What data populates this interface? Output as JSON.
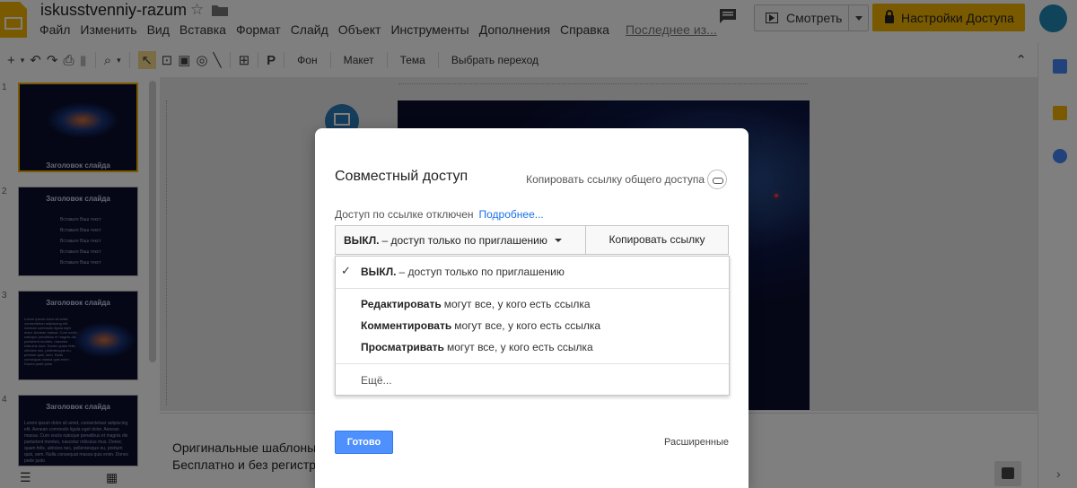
{
  "header": {
    "doc_title": "iskusstvenniy-razum",
    "menu": [
      "Файл",
      "Изменить",
      "Вид",
      "Вставка",
      "Формат",
      "Слайд",
      "Объект",
      "Инструменты",
      "Дополнения",
      "Справка"
    ],
    "last_edit": "Последнее из...",
    "present_label": "Смотреть",
    "share_label": "Настройки Доступа",
    "accent_color": "#f4b400"
  },
  "toolbar": {
    "background_label": "Фон",
    "layout_label": "Макет",
    "theme_label": "Тема",
    "transition_label": "Выбрать переход"
  },
  "filmstrip": {
    "slides": [
      {
        "number": "1",
        "title": "Заголовок слайда"
      },
      {
        "number": "2",
        "title": "Заголовок слайда",
        "items": [
          "Вставьте Ваш текст",
          "Вставьте Ваш текст",
          "Вставьте Ваш текст",
          "Вставьте Ваш текст",
          "Вставьте Ваш текст"
        ]
      },
      {
        "number": "3",
        "title": "Заголовок слайда"
      },
      {
        "number": "4",
        "title": "Заголовок слайда"
      }
    ],
    "body_text": "Lorem ipsum dolor sit amet, consectetuer adipiscing elit. Aenean commodo ligula eget dolor. Aenean massa. Cum sociis natoque penatibus et magnis dis parturient montes, nascetur ridiculus mus. Donec quam felis, ultricies nec, pellentesque eu, pretium quis, sem. Nulla consequat massa quis enim. Donec pede justo"
  },
  "notes": {
    "line1": "Оригинальные шаблоны д",
    "line2": "Бесплатно и без регистрац"
  },
  "dialog": {
    "title": "Совместный доступ",
    "copy_public_link": "Копировать ссылку общего доступа",
    "link_status": "Доступ по ссылке отключен",
    "more_link": "Подробнее...",
    "selected_bold": "ВЫКЛ.",
    "selected_rest": "– доступ только по приглашению",
    "copy_link_button": "Копировать ссылку",
    "options": [
      {
        "bold": "ВЫКЛ.",
        "rest": "– доступ только по приглашению",
        "checked": true
      },
      {
        "bold": "Редактировать",
        "rest": "могут все, у кого есть ссылка"
      },
      {
        "bold": "Комментировать",
        "rest": "могут все, у кого есть ссылка"
      },
      {
        "bold": "Просматривать",
        "rest": "могут все, у кого есть ссылка"
      }
    ],
    "more_option": "Ещё...",
    "done_button": "Готово",
    "advanced_link": "Расширенные"
  }
}
